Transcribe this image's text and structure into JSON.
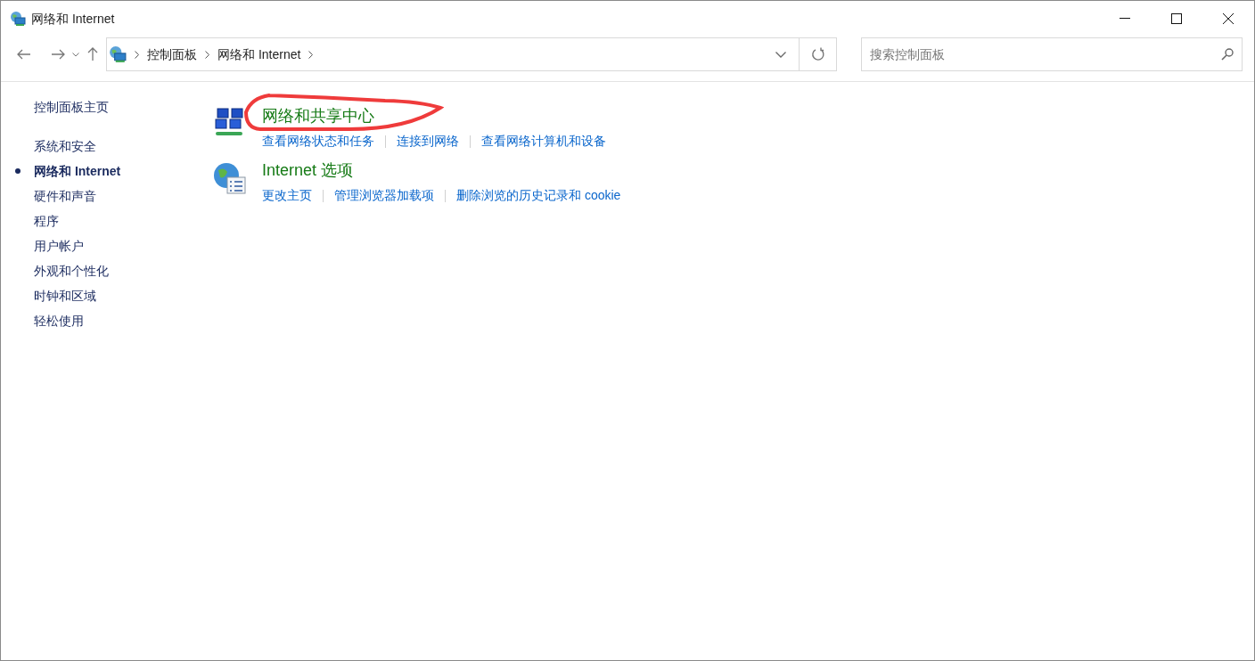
{
  "window": {
    "title": "网络和 Internet"
  },
  "breadcrumb": [
    "控制面板",
    "网络和 Internet"
  ],
  "search": {
    "placeholder": "搜索控制面板"
  },
  "sidebar": {
    "home": "控制面板主页",
    "items": [
      {
        "label": "系统和安全",
        "selected": false
      },
      {
        "label": "网络和 Internet",
        "selected": true
      },
      {
        "label": "硬件和声音",
        "selected": false
      },
      {
        "label": "程序",
        "selected": false
      },
      {
        "label": "用户帐户",
        "selected": false
      },
      {
        "label": "外观和个性化",
        "selected": false
      },
      {
        "label": "时钟和区域",
        "selected": false
      },
      {
        "label": "轻松使用",
        "selected": false
      }
    ]
  },
  "categories": [
    {
      "kind": "network",
      "title": "网络和共享中心",
      "circled": true,
      "links": [
        "查看网络状态和任务",
        "连接到网络",
        "查看网络计算机和设备"
      ]
    },
    {
      "kind": "internet",
      "title": "Internet 选项",
      "circled": false,
      "links": [
        "更改主页",
        "管理浏览器加载项",
        "删除浏览的历史记录和 cookie"
      ]
    }
  ]
}
